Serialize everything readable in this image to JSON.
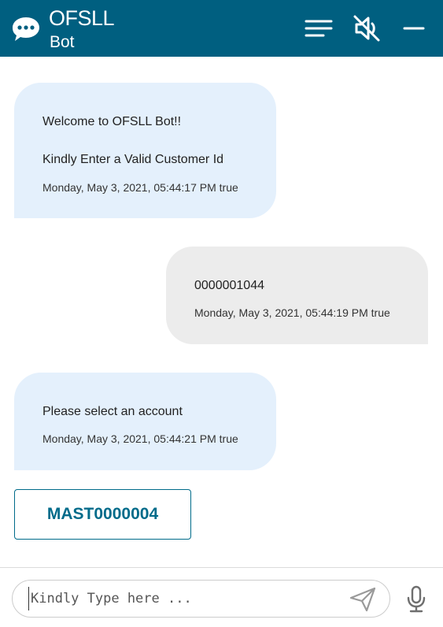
{
  "header": {
    "title": "OFSLL",
    "subtitle": "Bot",
    "bg_color": "#005f80",
    "icons": [
      "chat-bubble-icon",
      "menu-icon",
      "speaker-muted-icon",
      "minimize-icon"
    ]
  },
  "messages": [
    {
      "from": "bot",
      "lines": [
        "Welcome to OFSLL Bot!!",
        "Kindly Enter a Valid Customer Id"
      ],
      "timestamp": "Monday, May 3, 2021, 05:44:17 PM true"
    },
    {
      "from": "user",
      "lines": [
        "0000001044"
      ],
      "timestamp": "Monday, May 3, 2021, 05:44:19 PM true"
    },
    {
      "from": "bot",
      "lines": [
        "Please select an account"
      ],
      "timestamp": "Monday, May 3, 2021, 05:44:21 PM true"
    }
  ],
  "account_options": [
    "MAST0000004"
  ],
  "composer": {
    "placeholder": "Kindly Type here ...",
    "value": "",
    "icons": [
      "send-icon",
      "microphone-icon"
    ]
  },
  "colors": {
    "accent": "#006b8a",
    "bot_bubble": "#e4f0fc",
    "user_bubble": "#ececec"
  }
}
